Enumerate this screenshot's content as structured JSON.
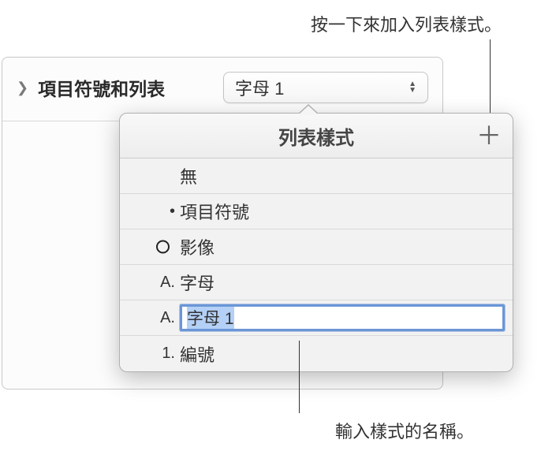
{
  "callouts": {
    "top": "按一下來加入列表樣式。",
    "bottom": "輸入樣式的名稱。"
  },
  "header": {
    "label": "項目符號和列表",
    "dropdown_value": "字母 1"
  },
  "popover": {
    "title": "列表樣式",
    "add_glyph": "＋",
    "items": [
      {
        "icon": "",
        "label": "無"
      },
      {
        "icon": "•",
        "label": "項目符號"
      },
      {
        "icon": "circle",
        "label": "影像"
      },
      {
        "icon": "A.",
        "label": "字母"
      },
      {
        "icon": "A.",
        "label": "字母 1",
        "editing": true
      },
      {
        "icon": "1.",
        "label": "編號"
      }
    ]
  }
}
